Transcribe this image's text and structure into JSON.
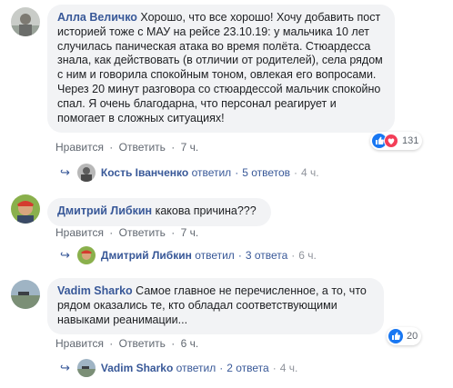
{
  "comments": [
    {
      "author": "Алла Величко",
      "text": "Хорошо, что все хорошо! Хочу добавить пост историей тоже с МАУ на рейсе 23.10.19: у мальчика 10 лет случилась паническая атака во время полёта. Стюардесса знала, как действовать (в отличии от родителей), села рядом с ним и говорила спокойным тоном, овлекая его вопросами. Через 20 минут разговора со стюардессой мальчик спокойно спал. Я очень благодарна, что персонал реагирует и помогает в сложных ситуациях!",
      "like_label": "Нравится",
      "reply_label": "Ответить",
      "time": "7 ч.",
      "reactions_count": "131",
      "reply": {
        "name": "Кость Іванченко",
        "action": "ответил",
        "count": "5 ответов",
        "time": "4 ч."
      }
    },
    {
      "author": "Дмитрий Либкин",
      "text": "какова причина???",
      "like_label": "Нравится",
      "reply_label": "Ответить",
      "time": "7 ч.",
      "reply": {
        "name": "Дмитрий Либкин",
        "action": "ответил",
        "count": "3 ответа",
        "time": "6 ч."
      }
    },
    {
      "author": "Vadim Sharko",
      "text": "Самое главное не перечисленное, а то, что рядом оказались те, кто обладал соответствующими навыками реанимации...",
      "like_label": "Нравится",
      "reply_label": "Ответить",
      "time": "6 ч.",
      "reactions_count": "20",
      "reply": {
        "name": "Vadim Sharko",
        "action": "ответил",
        "count": "2 ответа",
        "time": "4 ч."
      }
    }
  ],
  "separator": "·",
  "colors": {
    "link": "#385898",
    "bubble": "#f2f3f5",
    "like": "#1877f2",
    "love": "#f33e58"
  }
}
